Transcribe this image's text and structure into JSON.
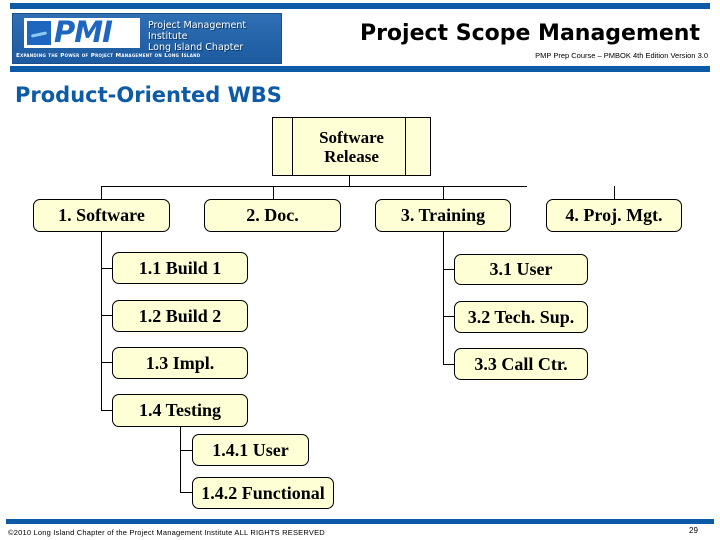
{
  "header": {
    "logo": {
      "mark_text": "PMI",
      "org_name_line1": "Project Management Institute",
      "org_name_line2": "Long Island Chapter",
      "tagline": "Expanding the Power of Project Management on Long Island"
    },
    "title": "Project Scope Management",
    "subtitle": "PMP Prep Course – PMBOK 4th Edition Version 3.0"
  },
  "section_title": "Product-Oriented WBS",
  "wbs": {
    "root": {
      "line1": "Software",
      "line2": "Release"
    },
    "level1": [
      {
        "label": "1. Software"
      },
      {
        "label": "2. Doc."
      },
      {
        "label": "3. Training"
      },
      {
        "label": "4. Proj. Mgt."
      }
    ],
    "software_children": [
      {
        "label": "1.1 Build 1"
      },
      {
        "label": "1.2 Build 2"
      },
      {
        "label": "1.3 Impl."
      },
      {
        "label": "1.4 Testing"
      }
    ],
    "testing_children": [
      {
        "label": "1.4.1 User"
      },
      {
        "label": "1.4.2 Functional"
      }
    ],
    "training_children": [
      {
        "label": "3.1 User"
      },
      {
        "label": "3.2 Tech. Sup."
      },
      {
        "label": "3.3 Call Ctr."
      }
    ]
  },
  "footer": {
    "copyright": "©2010 Long Island Chapter of the Project Management Institute  ALL RIGHTS RESERVED",
    "page_number": "29"
  },
  "colors": {
    "brand_blue": "#0d5ba6",
    "node_fill": "#ffffd6"
  }
}
